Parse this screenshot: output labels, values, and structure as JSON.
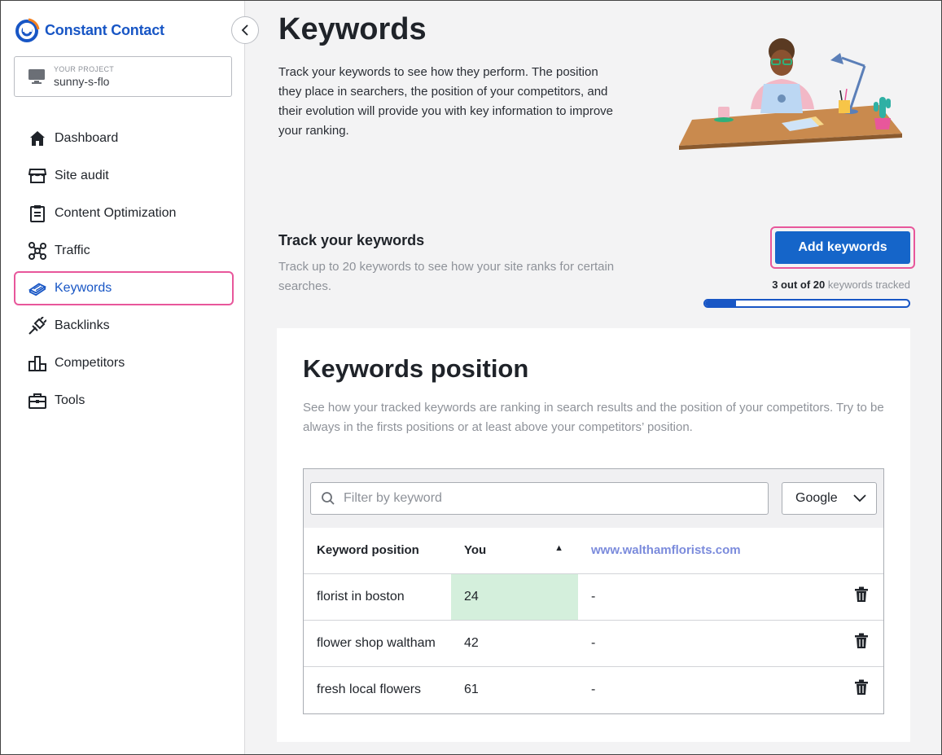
{
  "brand": {
    "name": "Constant Contact",
    "color": "#1856c5"
  },
  "project": {
    "label": "YOUR PROJECT",
    "value": "sunny-s-flo"
  },
  "nav": [
    {
      "label": "Dashboard",
      "icon": "home-icon"
    },
    {
      "label": "Site audit",
      "icon": "storefront-icon"
    },
    {
      "label": "Content Optimization",
      "icon": "clipboard-icon"
    },
    {
      "label": "Traffic",
      "icon": "network-icon"
    },
    {
      "label": "Keywords",
      "icon": "keyboard-stack-icon",
      "active": true
    },
    {
      "label": "Backlinks",
      "icon": "plug-icon"
    },
    {
      "label": "Competitors",
      "icon": "podium-icon"
    },
    {
      "label": "Tools",
      "icon": "toolbox-icon"
    }
  ],
  "header": {
    "title": "Keywords",
    "description": "Track your keywords to see how they perform. The position they place in searchers, the position of your competitors, and their evolution will provide you with key information to improve your ranking."
  },
  "track": {
    "title": "Track your keywords",
    "description": "Track up to 20 keywords to see how your site ranks for certain searches.",
    "button": "Add keywords",
    "count": "3 out of 20",
    "count_suffix": " keywords tracked",
    "progress_fraction": 0.15
  },
  "position": {
    "title": "Keywords position",
    "description": "See how your tracked keywords are ranking in search results and the position of your competitors. Try to be always in the firsts positions or at least above your competitors’ position.",
    "filter_placeholder": "Filter by keyword",
    "engine": "Google",
    "columns": {
      "keyword": "Keyword position",
      "you": "You",
      "competitor": "www.walthamflorists.com"
    },
    "rows": [
      {
        "keyword": "florist in boston",
        "you": "24",
        "competitor": "-"
      },
      {
        "keyword": "flower shop waltham",
        "you": "42",
        "competitor": "-"
      },
      {
        "keyword": "fresh local flowers",
        "you": "61",
        "competitor": "-"
      }
    ]
  },
  "colors": {
    "accent": "#1565c9",
    "highlight": "#e8579b",
    "good_cell": "#d4efdc"
  }
}
